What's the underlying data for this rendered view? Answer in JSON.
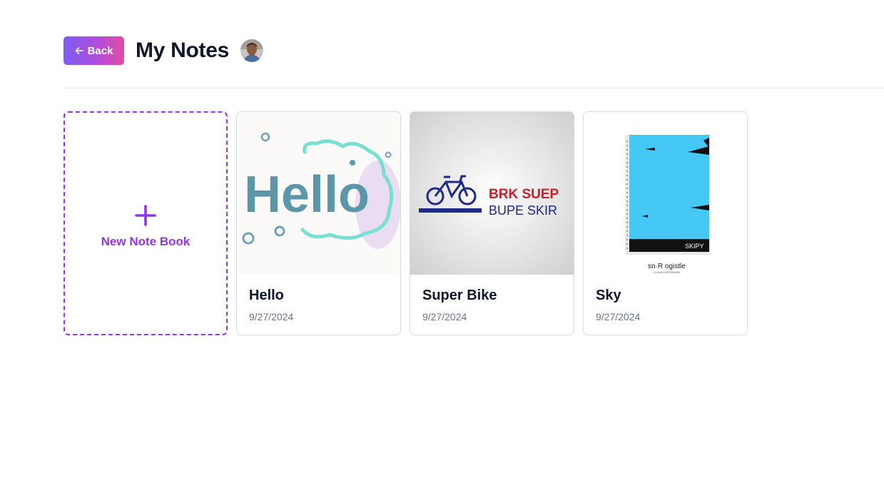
{
  "header": {
    "back_label": "Back",
    "title": "My Notes"
  },
  "new_notebook": {
    "label": "New Note Book"
  },
  "notebooks": [
    {
      "title": "Hello",
      "date": "9/27/2024",
      "cover_text": "Hello",
      "cover_icon": "hello-cloud-cover"
    },
    {
      "title": "Super Bike",
      "date": "9/27/2024",
      "cover_text_line1": "BRK SUEP",
      "cover_text_line2": "BUPE SKIR",
      "cover_icon": "bicycle-icon"
    },
    {
      "title": "Sky",
      "date": "9/27/2024",
      "cover_label": "SKIPY",
      "cover_caption": "sn·R ogistle",
      "cover_subcaption": "CLOUD NOTEBOOK",
      "cover_icon": "notebook-cover"
    }
  ],
  "colors": {
    "accent": "#9333ea",
    "back_gradient_start": "#7b5cf5",
    "back_gradient_end": "#e34aa6"
  }
}
